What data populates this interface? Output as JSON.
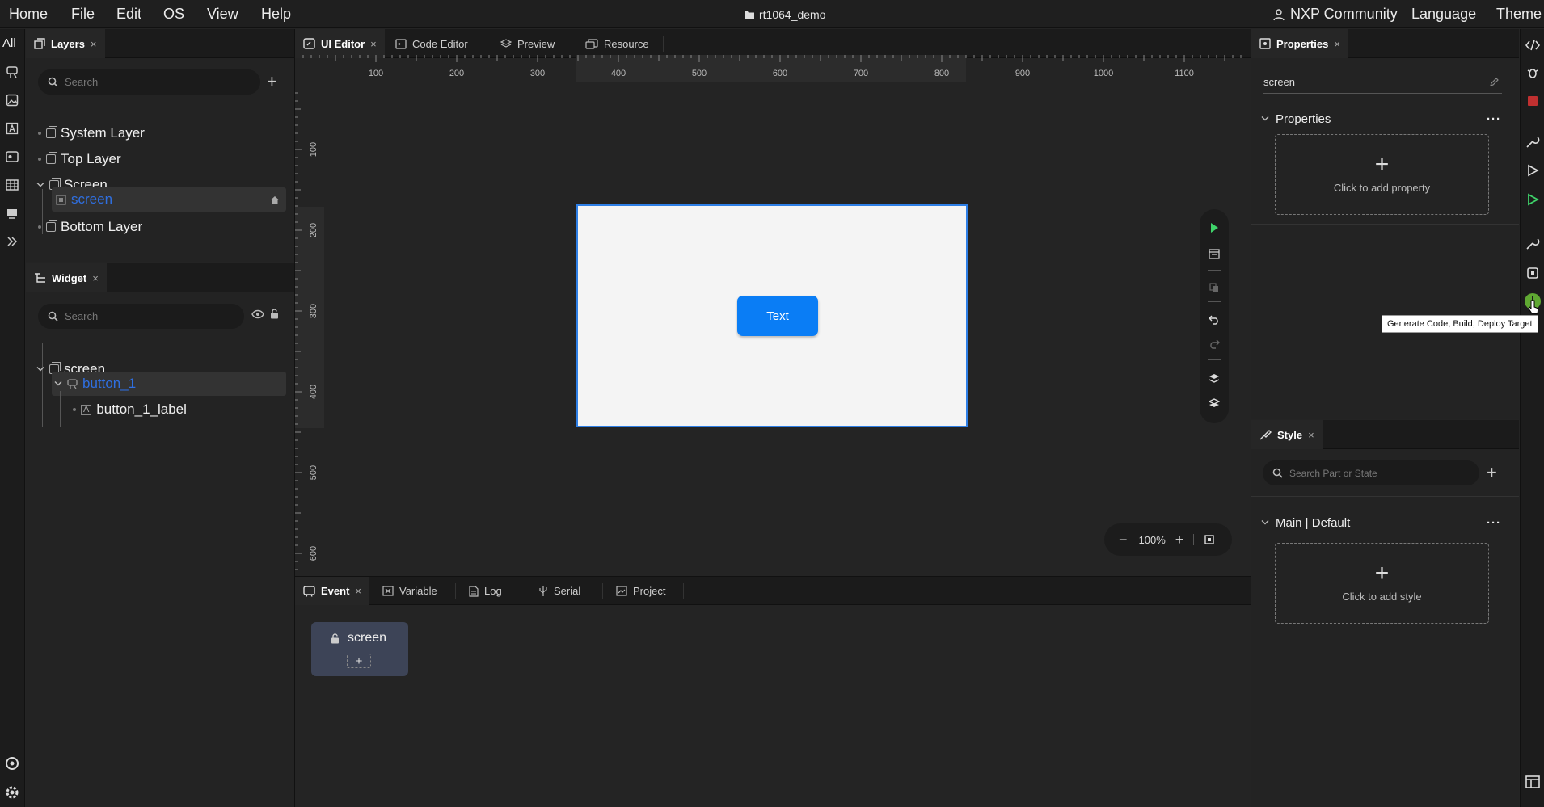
{
  "menu": {
    "home": "Home",
    "file": "File",
    "edit": "Edit",
    "os": "OS",
    "view": "View",
    "help": "Help",
    "project": "rt1064_demo",
    "community": "NXP Community",
    "language": "Language",
    "theme": "Theme"
  },
  "leftbar": {
    "all": "All"
  },
  "layers": {
    "tab": "Layers",
    "close": "×",
    "search_placeholder": "Search",
    "items": [
      "System Layer",
      "Top Layer",
      "Screen",
      "screen",
      "Bottom Layer"
    ]
  },
  "widget": {
    "tab": "Widget",
    "close": "×",
    "search_placeholder": "Search",
    "items": [
      "screen",
      "button_1",
      "button_1_label"
    ]
  },
  "editor": {
    "tabs": [
      "UI Editor",
      "Code Editor",
      "Preview",
      "Resource"
    ],
    "close": "×",
    "zoom": "100%",
    "ruler_h": [
      "100",
      "200",
      "300",
      "400",
      "500",
      "600",
      "700",
      "800",
      "900",
      "1000",
      "1100"
    ],
    "ruler_v": [
      "100",
      "200",
      "300",
      "400",
      "500",
      "600"
    ],
    "button_text": "Text"
  },
  "bottom": {
    "tabs": [
      "Event",
      "Variable",
      "Log",
      "Serial",
      "Project"
    ],
    "close": "×",
    "event_card": "screen"
  },
  "properties": {
    "tab": "Properties",
    "close": "×",
    "name": "screen",
    "section": "Properties",
    "add": "Click to add property"
  },
  "style": {
    "tab": "Style",
    "close": "×",
    "search_placeholder": "Search Part or State",
    "section": "Main | Default",
    "add": "Click to add style"
  },
  "tooltip": "Generate Code, Build, Deploy Target",
  "colors": {
    "accent": "#0a7df5",
    "canvas": "#f4f4f4",
    "selected_text": "#2f6fe0",
    "run_green": "#3fd36a"
  }
}
